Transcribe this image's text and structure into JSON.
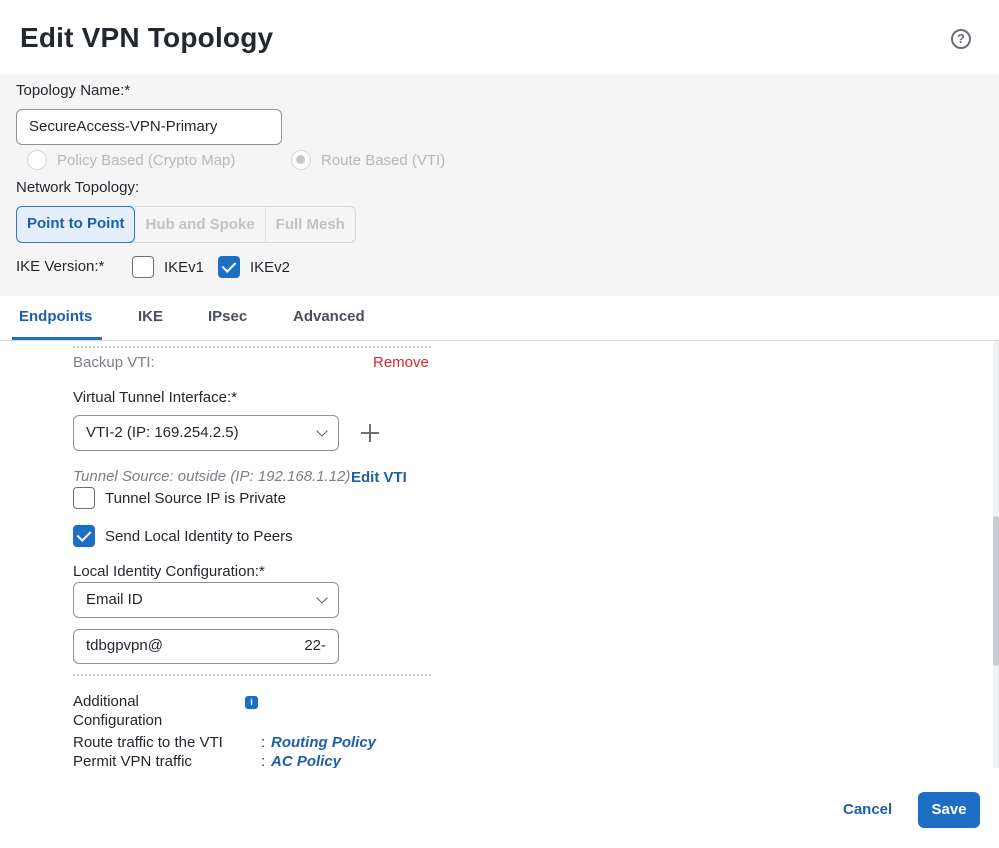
{
  "dialog": {
    "title": "Edit VPN Topology",
    "help_icon": "question-circle-icon",
    "help_glyph": "?"
  },
  "settings": {
    "topology_name_label": "Topology Name:*",
    "topology_name_value": "SecureAccess-VPN-Primary",
    "policy_based_label": "Policy Based (Crypto Map)",
    "route_based_label": "Route Based (VTI)",
    "selected_type": "Route Based (VTI)",
    "network_topology_label": "Network Topology:",
    "topology_options": [
      "Point to Point",
      "Hub and Spoke",
      "Full Mesh"
    ],
    "selected_topology": "Point to Point",
    "ike_version_label": "IKE Version:*",
    "ikev1_label": "IKEv1",
    "ikev1_checked": false,
    "ikev2_label": "IKEv2",
    "ikev2_checked": true
  },
  "tabs": {
    "items": [
      "Endpoints",
      "IKE",
      "IPsec",
      "Advanced"
    ],
    "active": "Endpoints"
  },
  "endpoint": {
    "backup_vti_label": "Backup VTI:",
    "remove_label": "Remove",
    "vti_label": "Virtual Tunnel Interface:*",
    "vti_value": "VTI-2 (IP: 169.254.2.5)",
    "tunnel_source_note": "Tunnel Source: outside (IP: 192.168.1.12)",
    "edit_vti_label": "Edit VTI",
    "tunnel_private_label": "Tunnel Source IP is Private",
    "tunnel_private_checked": false,
    "send_identity_label": "Send Local Identity to Peers",
    "send_identity_checked": true,
    "local_identity_label": "Local Identity Configuration:*",
    "local_identity_value": "Email ID",
    "email_value": "tdbgpvpn@",
    "email_tail": "22-",
    "additional_config_line1": "Additional",
    "additional_config_line2": "Configuration",
    "info_icon": "info-icon",
    "info_glyph": "i",
    "route_traffic_label": "Route traffic to the VTI",
    "route_traffic_link": "Routing Policy",
    "permit_traffic_label": "Permit VPN traffic",
    "permit_traffic_link": "AC Policy",
    "separator": ":"
  },
  "footer": {
    "cancel_label": "Cancel",
    "save_label": "Save"
  },
  "colors": {
    "accent": "#1d6fc5",
    "danger": "#d6282e",
    "panel_bg": "#f5f5f6"
  }
}
